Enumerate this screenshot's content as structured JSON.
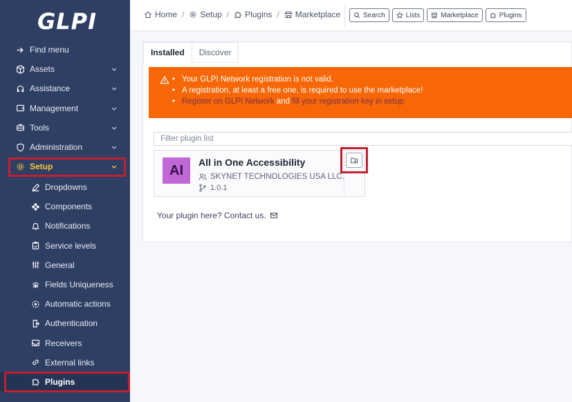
{
  "app": {
    "logo": "GLPI"
  },
  "sidebar": {
    "items": [
      {
        "label": "Find menu",
        "icon": "find-menu-icon",
        "chevron": false
      },
      {
        "label": "Assets",
        "icon": "box-icon",
        "chevron": true
      },
      {
        "label": "Assistance",
        "icon": "headset-icon",
        "chevron": true
      },
      {
        "label": "Management",
        "icon": "wallet-icon",
        "chevron": true
      },
      {
        "label": "Tools",
        "icon": "briefcase-icon",
        "chevron": true
      },
      {
        "label": "Administration",
        "icon": "shield-icon",
        "chevron": true
      },
      {
        "label": "Setup",
        "icon": "gear-icon",
        "chevron": true
      }
    ],
    "setup_items": [
      {
        "label": "Dropdowns",
        "icon": "edit-icon"
      },
      {
        "label": "Components",
        "icon": "components-icon"
      },
      {
        "label": "Notifications",
        "icon": "bell-icon"
      },
      {
        "label": "Service levels",
        "icon": "clipboard-icon"
      },
      {
        "label": "General",
        "icon": "sliders-icon"
      },
      {
        "label": "Fields Uniqueness",
        "icon": "fingerprint-icon"
      },
      {
        "label": "Automatic actions",
        "icon": "cog-icon"
      },
      {
        "label": "Authentication",
        "icon": "login-icon"
      },
      {
        "label": "Receivers",
        "icon": "inbox-icon"
      },
      {
        "label": "External links",
        "icon": "link-icon"
      },
      {
        "label": "Plugins",
        "icon": "puzzle-icon"
      }
    ]
  },
  "breadcrumb": {
    "home": "Home",
    "setup": "Setup",
    "plugins": "Plugins",
    "marketplace": "Marketplace"
  },
  "toolbar": {
    "search": "Search",
    "lists": "Lists",
    "marketplace": "Marketplace",
    "plugins": "Plugins"
  },
  "tabs": {
    "installed": "Installed",
    "discover": "Discover"
  },
  "alert": {
    "line1": "Your GLPI Network registration is not valid.",
    "line2": "A registration, at least a free one, is required to use the marketplace!",
    "line3_link1": "Register on GLPI Network",
    "line3_and": "and",
    "line3_link2": "fill your registration key in setup."
  },
  "filter": {
    "placeholder": "Filter plugin list"
  },
  "plugin": {
    "badge": "AI",
    "name": "All in One Accessibility",
    "author": "SKYNET TECHNOLOGIES USA LLC.",
    "version": "1.0.1"
  },
  "contact": {
    "text": "Your plugin here? Contact us."
  },
  "colors": {
    "sidebar": "#2f3f64",
    "accent": "#f9c43a",
    "alert": "#f76707",
    "highlight": "#c21f2f",
    "badge": "#c069d6"
  }
}
